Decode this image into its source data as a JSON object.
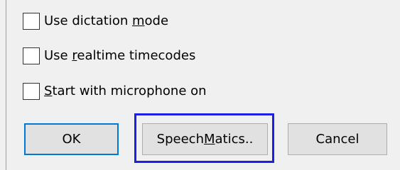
{
  "checkboxes": [
    {
      "label_pre": "Use dictation ",
      "label_accel": "m",
      "label_post": "ode",
      "checked": false
    },
    {
      "label_pre": "Use ",
      "label_accel": "r",
      "label_post": "ealtime timecodes",
      "checked": false
    },
    {
      "label_pre": "",
      "label_accel": "S",
      "label_post": "tart with microphone on",
      "checked": false
    }
  ],
  "buttons": {
    "ok_label": "OK",
    "speech_label_pre": "Speech",
    "speech_label_accel": "M",
    "speech_label_post": "atics..",
    "cancel_label": "Cancel"
  },
  "colors": {
    "dialog_bg": "#f0f0f0",
    "button_bg": "#e1e1e1",
    "default_button_border": "#0078d7",
    "highlight_frame": "#1e1ee6"
  }
}
